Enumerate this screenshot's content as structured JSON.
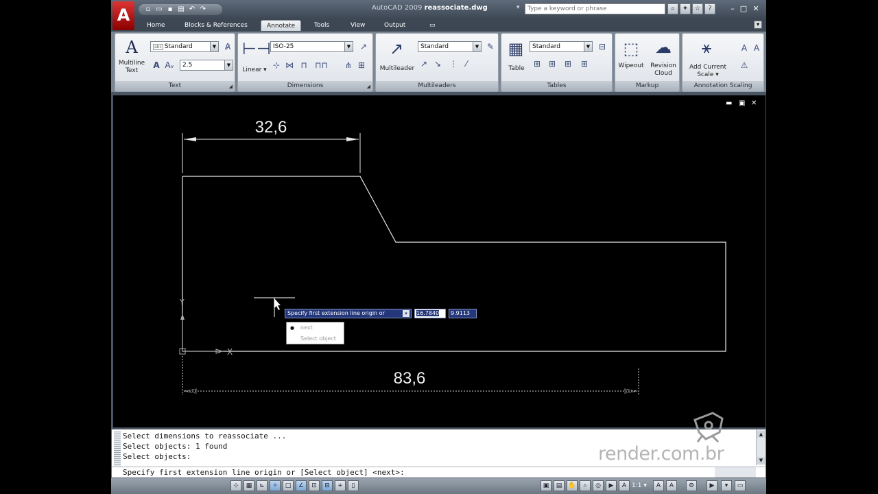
{
  "title_bar": {
    "app_name": "AutoCAD 2009",
    "file_name": "reassociate.dwg",
    "search_placeholder": "Type a keyword or phrase",
    "logo_letter": "A"
  },
  "tabs": [
    {
      "label": "Home"
    },
    {
      "label": "Blocks & References"
    },
    {
      "label": "Annotate"
    },
    {
      "label": "Tools"
    },
    {
      "label": "View"
    },
    {
      "label": "Output"
    }
  ],
  "ribbon": {
    "text_panel": {
      "title": "Text",
      "big_button_label": "Multiline Text",
      "style_value": "Standard",
      "height_value": "2.5"
    },
    "dimensions_panel": {
      "title": "Dimensions",
      "big_button_label": "Linear",
      "style_value": "ISO-25"
    },
    "multileaders_panel": {
      "title": "Multileaders",
      "big_button_label": "Multileader",
      "style_value": "Standard"
    },
    "tables_panel": {
      "title": "Tables",
      "big_button_label": "Table",
      "style_value": "Standard"
    },
    "markup_panel": {
      "title": "Markup",
      "wipeout_label": "Wipeout",
      "revcloud_label": "Revision Cloud"
    },
    "annotation_scaling_panel": {
      "title": "Annotation Scaling",
      "add_scale_label": "Add Current Scale"
    }
  },
  "drawing": {
    "dim_top_text": "32,6",
    "dim_bottom_text": "83,6",
    "ucs_x_label": "X",
    "ucs_y_label": "Y"
  },
  "dynamic_input": {
    "prompt": "Specify first extension line origin or",
    "x_value": "16.7840",
    "y_value": "9.9113",
    "options": [
      "next",
      "Select object"
    ]
  },
  "command_line": {
    "history": [
      "Select dimensions to reassociate ...",
      "Select objects: 1 found",
      "Select objects:"
    ],
    "current": "Specify first extension line origin or [Select object] <next>:"
  },
  "status_bar": {
    "scale": "1:1"
  },
  "watermark": {
    "text": "render.com.br"
  }
}
